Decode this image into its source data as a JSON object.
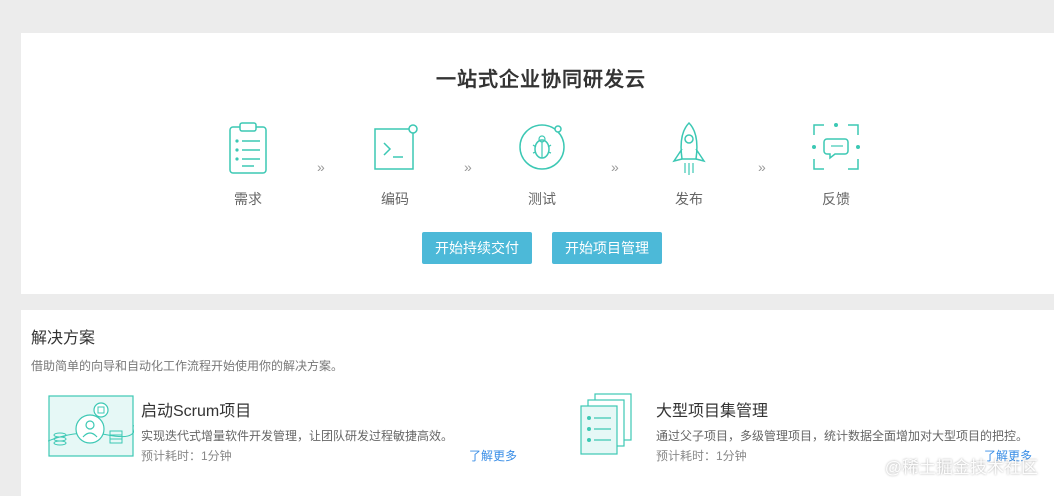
{
  "hero": {
    "title": "一站式企业协同研发云",
    "steps": [
      {
        "label": "需求",
        "icon": "clipboard-icon"
      },
      {
        "label": "编码",
        "icon": "terminal-icon"
      },
      {
        "label": "测试",
        "icon": "bug-icon"
      },
      {
        "label": "发布",
        "icon": "rocket-icon"
      },
      {
        "label": "反馈",
        "icon": "chat-feedback-icon"
      }
    ],
    "chevron": "»",
    "buttons": {
      "continuous_delivery": "开始持续交付",
      "project_management": "开始项目管理"
    }
  },
  "solutions": {
    "title": "解决方案",
    "description": "借助简单的向导和自动化工作流程开始使用你的解决方案。",
    "items": [
      {
        "name": "启动Scrum项目",
        "text": "实现迭代式增量软件开发管理，让团队研发过程敏捷高效。",
        "time": "预计耗时：1分钟",
        "more": "了解更多"
      },
      {
        "name": "大型项目集管理",
        "text": "通过父子项目，多级管理项目，统计数据全面增加对大型项目的把控。",
        "time": "预计耗时：1分钟",
        "more": "了解更多"
      }
    ]
  },
  "watermark": "@稀土掘金技术社区",
  "colors": {
    "accent": "#4cb9d8",
    "icon_stroke": "#3cc8b4",
    "link": "#3a8ee6",
    "background": "#ececec"
  }
}
